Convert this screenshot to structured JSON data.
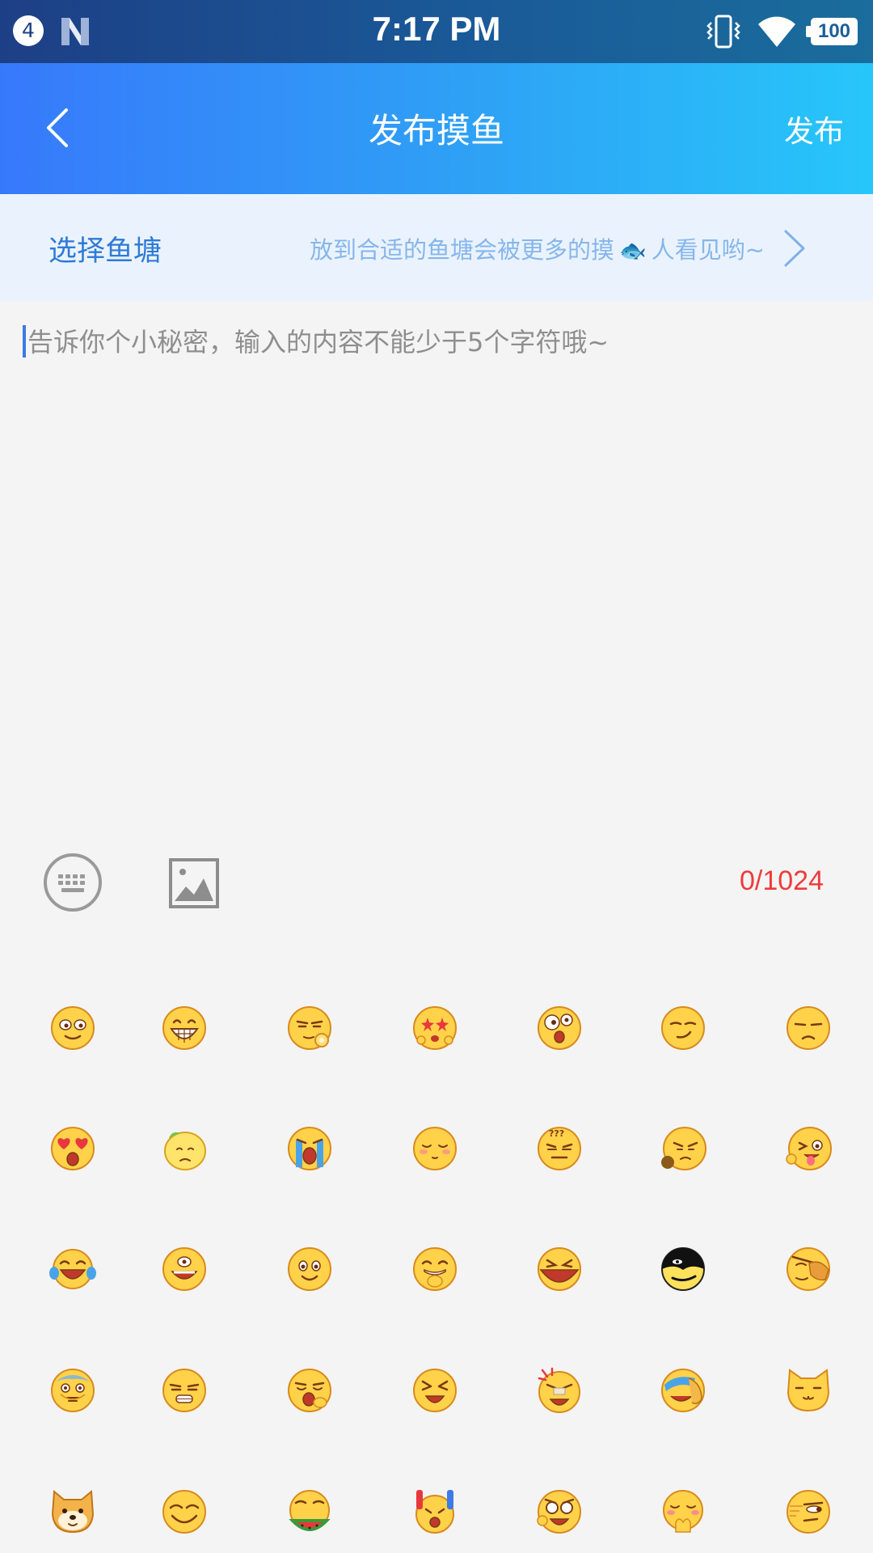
{
  "status_bar": {
    "notification_count": "4",
    "time": "7:17 PM",
    "battery": "100"
  },
  "header": {
    "title": "发布摸鱼",
    "publish_label": "发布"
  },
  "pond": {
    "label": "选择鱼塘",
    "hint_before": "放到合适的鱼塘会被更多的摸",
    "hint_after": "人看见哟~"
  },
  "editor": {
    "placeholder": "告诉你个小秘密，输入的内容不能少于5个字符哦~",
    "counter": "0/1024"
  },
  "emoji_picker": {
    "rows": 5,
    "columns": 7,
    "icons": [
      "smile-face-icon",
      "grin-teeth-icon",
      "ok-hand-face-icon",
      "star-eyes-icon",
      "shocked-face-icon",
      "smirk-face-icon",
      "unamused-face-icon",
      "heart-eyes-icon",
      "lemon-sour-face-icon",
      "crying-face-icon",
      "blush-face-icon",
      "confused-face-icon",
      "facepalm-thinking-icon",
      "tongue-wink-icon",
      "tears-of-joy-icon",
      "laugh-face-icon",
      "simple-smile-icon",
      "giggle-face-icon",
      "angry-shout-icon",
      "black-mask-face-icon",
      "cover-face-icon",
      "old-man-face-icon",
      "squint-face-icon",
      "yawn-face-icon",
      "shout-face-icon",
      "bandage-face-icon",
      "laugh-cry-side-icon",
      "cat-face-icon",
      "doge-face-icon",
      "happy-closed-eyes-icon",
      "watermelon-face-icon",
      "lightsticks-face-icon",
      "angry-glasses-icon",
      "shy-hands-icon",
      "sideeye-face-icon"
    ]
  }
}
